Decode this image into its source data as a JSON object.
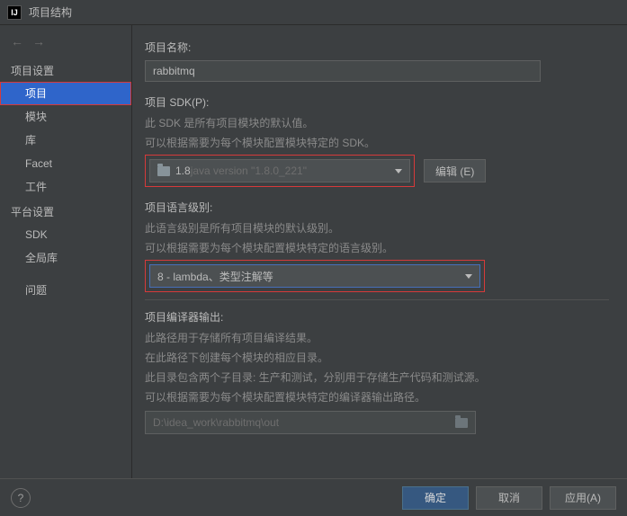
{
  "titlebar": {
    "title": "项目结构"
  },
  "nav": {
    "back": "←",
    "forward": "→"
  },
  "sidebar": {
    "section1": "项目设置",
    "items1": [
      "项目",
      "模块",
      "库",
      "Facet",
      "工件"
    ],
    "section2": "平台设置",
    "items2": [
      "SDK",
      "全局库"
    ],
    "section3": "问题"
  },
  "content": {
    "projectName": {
      "label": "项目名称:",
      "value": "rabbitmq"
    },
    "sdk": {
      "label": "项目 SDK(P):",
      "desc1": "此 SDK 是所有项目模块的默认值。",
      "desc2": "可以根据需要为每个模块配置模块特定的 SDK。",
      "value_prefix": "1.8 ",
      "value_suffix": "java version \"1.8.0_221\"",
      "editBtn": "编辑  (E)"
    },
    "lang": {
      "label": "项目语言级别:",
      "desc1": "此语言级别是所有项目模块的默认级别。",
      "desc2": "可以根据需要为每个模块配置模块特定的语言级别。",
      "value": "8 - lambda、类型注解等"
    },
    "output": {
      "label": "项目编译器输出:",
      "desc1": "此路径用于存储所有项目编译结果。",
      "desc2": "在此路径下创建每个模块的相应目录。",
      "desc3": "此目录包含两个子目录:  生产和测试，分别用于存储生产代码和测试源。",
      "desc4": "可以根据需要为每个模块配置模块特定的编译器输出路径。",
      "value": "D:\\idea_work\\rabbitmq\\out"
    }
  },
  "footer": {
    "help": "?",
    "ok": "确定",
    "cancel": "取消",
    "apply": "应用(A)"
  }
}
